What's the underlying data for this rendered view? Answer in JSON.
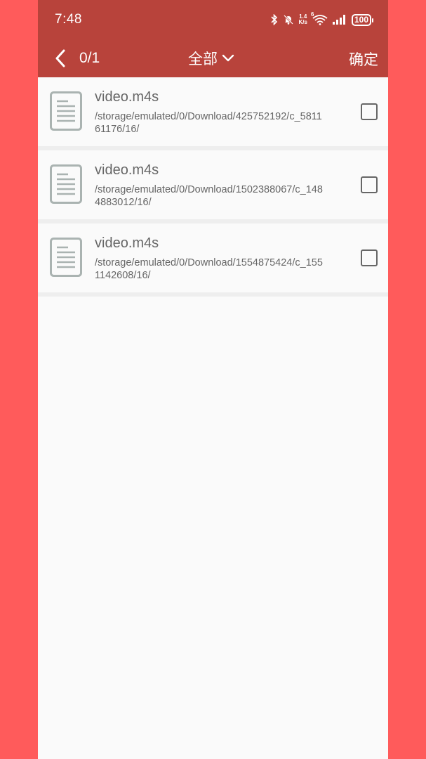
{
  "status_bar": {
    "time": "7:48",
    "net_speed_value": "1.4",
    "net_speed_unit": "K/s",
    "wifi_badge": "6",
    "battery": "100"
  },
  "toolbar": {
    "counter": "0/1",
    "filter_label": "全部",
    "confirm_label": "确定"
  },
  "files": [
    {
      "name": "video.m4s",
      "path": "/storage/emulated/0/Download/425752192/c_581161176/16/",
      "checked": false
    },
    {
      "name": "video.m4s",
      "path": "/storage/emulated/0/Download/1502388067/c_1484883012/16/",
      "checked": false
    },
    {
      "name": "video.m4s",
      "path": "/storage/emulated/0/Download/1554875424/c_1551142608/16/",
      "checked": false
    }
  ],
  "icons": {
    "back": "chevron-left-icon",
    "filter": "chevron-down-icon",
    "file": "document-icon",
    "bluetooth": "bluetooth-icon",
    "mute": "bell-off-icon",
    "wifi": "wifi-icon",
    "signal": "signal-icon",
    "battery": "battery-icon"
  },
  "colors": {
    "header": "#b8433b",
    "side_background": "#ff5b5b",
    "list_background": "#fafafa",
    "text_secondary": "#666666"
  }
}
